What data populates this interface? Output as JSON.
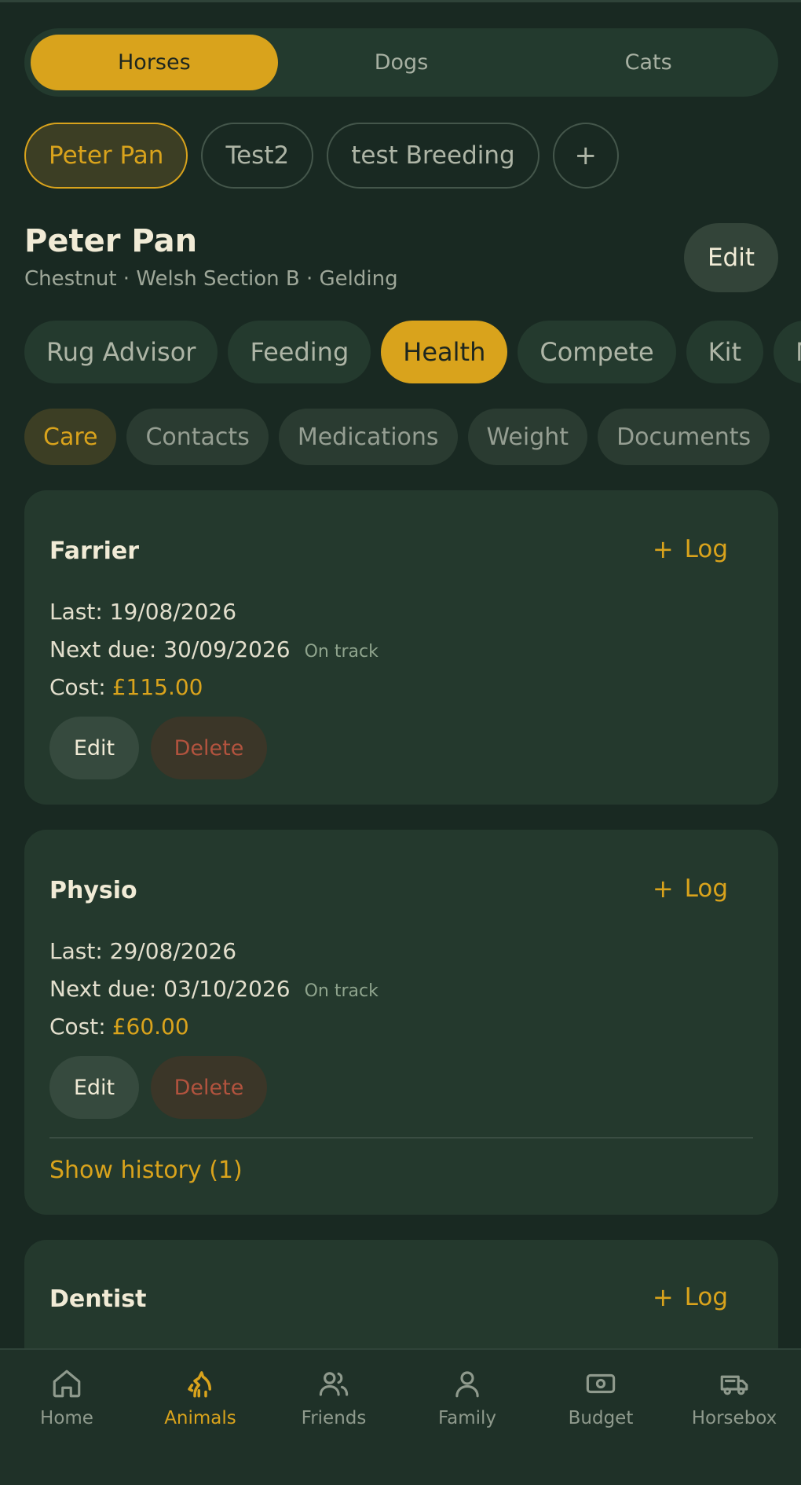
{
  "species_tabs": [
    {
      "label": "Horses",
      "active": true
    },
    {
      "label": "Dogs",
      "active": false
    },
    {
      "label": "Cats",
      "active": false
    }
  ],
  "animals": [
    {
      "label": "Peter Pan",
      "active": true
    },
    {
      "label": "Test2",
      "active": false
    },
    {
      "label": "test Breeding",
      "active": false
    }
  ],
  "add_animal_label": "+",
  "header": {
    "name": "Peter Pan",
    "subtitle": "Chestnut · Welsh Section B · Gelding",
    "edit_label": "Edit"
  },
  "sections": [
    "Rug Advisor",
    "Feeding",
    "Health",
    "Compete",
    "Kit",
    "Mon"
  ],
  "active_section": "Health",
  "subtabs": [
    "Care",
    "Contacts",
    "Medications",
    "Weight",
    "Documents"
  ],
  "active_subtab": "Care",
  "cards": {
    "farrier": {
      "title": "Farrier",
      "log_label": "Log",
      "last_label": "Last:",
      "last": "19/08/2026",
      "next_label": "Next due:",
      "next": "30/09/2026",
      "status": "On track",
      "cost_label": "Cost:",
      "cost": "£115.00",
      "edit_label": "Edit",
      "delete_label": "Delete"
    },
    "physio": {
      "title": "Physio",
      "log_label": "Log",
      "last_label": "Last:",
      "last": "29/08/2026",
      "next_label": "Next due:",
      "next": "03/10/2026",
      "status": "On track",
      "cost_label": "Cost:",
      "cost": "£60.00",
      "edit_label": "Edit",
      "delete_label": "Delete",
      "history_label": "Show history (1)"
    },
    "dentist": {
      "title": "Dentist",
      "log_label": "Log"
    }
  },
  "nav": [
    {
      "label": "Home",
      "icon": "home-icon",
      "active": false
    },
    {
      "label": "Animals",
      "icon": "horse-icon",
      "active": true
    },
    {
      "label": "Friends",
      "icon": "friends-icon",
      "active": false
    },
    {
      "label": "Family",
      "icon": "person-icon",
      "active": false
    },
    {
      "label": "Budget",
      "icon": "banknote-icon",
      "active": false
    },
    {
      "label": "Horsebox",
      "icon": "trailer-icon",
      "active": false
    }
  ],
  "colors": {
    "background": "#192922",
    "card": "#24392d",
    "accent": "#d9a31c",
    "danger": "#b2533e"
  }
}
